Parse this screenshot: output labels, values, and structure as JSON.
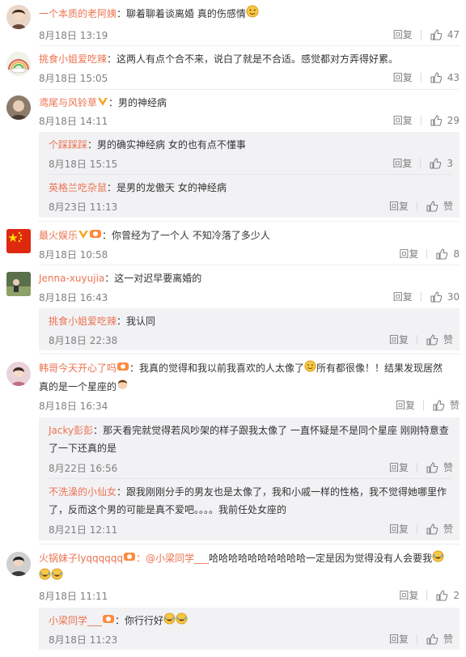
{
  "labels": {
    "reply": "回复",
    "like_zero": "赞"
  },
  "colors": {
    "username": "#eb7350",
    "meta": "#808080",
    "sub_bg": "#f2f2f5"
  },
  "comments": [
    {
      "user": "一个本质的老阿姨",
      "text": "：聊着聊着谈离婚 真的伤感情",
      "time": "8月18日 13:19",
      "likes": "47",
      "emoji": "wink-emoji"
    },
    {
      "user": "挑食小姐爱吃辣",
      "text": "：这两人有点个合不来，说白了就是不合适。感觉都对方弄得好累。",
      "time": "8月18日 15:05",
      "likes": "43"
    },
    {
      "user": "鸢尾与风铃草",
      "text": "：男的神经病",
      "time": "8月18日 14:11",
      "likes": "29",
      "replies": [
        {
          "user": "个踩踩踩",
          "text": "：男的确实神经病 女的也有点不懂事",
          "time": "8月18日 15:15",
          "likes": "3"
        },
        {
          "user": "英格兰吃杂鼠",
          "text": "：是男的龙傲天 女的神经病",
          "time": "8月23日 11:13",
          "likes": "赞"
        }
      ]
    },
    {
      "user": "最火娱乐",
      "text": "：你曾经为了一个人 不知冷落了多少人",
      "time": "8月18日 10:58",
      "likes": "8"
    },
    {
      "user": "Jenna-xuyujia",
      "text": "：这一对迟早要离婚的",
      "time": "8月18日 16:43",
      "likes": "30",
      "replies": [
        {
          "user": "挑食小姐爱吃辣",
          "text": "：我认同",
          "time": "8月18日 22:38",
          "likes": "赞"
        }
      ]
    },
    {
      "user": "韩哥今天开心了吗",
      "text_a": "：我真的觉得和我以前我喜欢的人太像了",
      "text_b": "所有都很像！！结果发现居然真的是一个星座的",
      "time": "8月18日 16:34",
      "likes": "赞",
      "replies": [
        {
          "user": "Jacky彭彭",
          "text": "：那天看完就觉得若风吵架的样子跟我太像了 一直怀疑是不是同个星座 刚刚特意查了一下还真的是",
          "time": "8月22日 16:56",
          "likes": "赞"
        },
        {
          "user": "不洗澡的小仙女",
          "text": "：跟我刚刚分手的男友也是太像了，我和小戚一样的性格，我不觉得她哪里作了，反而这个男的可能是真不爱吧。。。。我前任处女座的",
          "time": "8月21日 12:11",
          "likes": "赞"
        }
      ]
    },
    {
      "user": "火锅妹子lyqqqqqq",
      "mention": "：@小梁同学___",
      "text": "哈哈哈哈哈哈哈哈哈哈一定是因为觉得没有人会要我",
      "time": "8月18日 11:11",
      "likes": "2",
      "replies": [
        {
          "user": "小梁同学___",
          "text": "：你行行好",
          "time": "8月18日 11:23",
          "likes": "赞"
        }
      ]
    }
  ]
}
